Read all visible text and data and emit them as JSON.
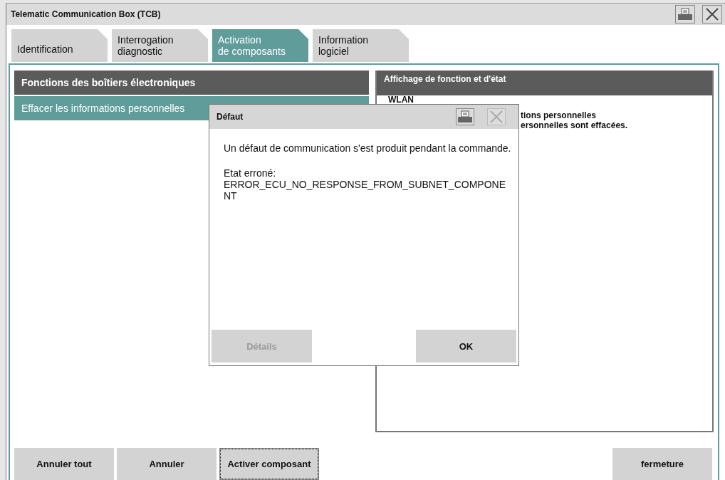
{
  "window": {
    "title": "Telematic Communication Box (TCB)"
  },
  "tabs": [
    {
      "label": "Identification",
      "selected": false
    },
    {
      "label": "Interrogation\ndiagnostic",
      "selected": false
    },
    {
      "label": "Activation\nde composants",
      "selected": true
    },
    {
      "label": "Information\nlogiciel",
      "selected": false
    }
  ],
  "functions_panel": {
    "title": "Fonctions des boîtiers électroniques",
    "items": [
      {
        "label": "Effacer les informations personnelles",
        "selected": true
      }
    ]
  },
  "status_panel": {
    "title": "Affichage de fonction et d'état",
    "heading": "WLAN",
    "lines": [
      "tions personnelles",
      "ersonnelles sont effacées."
    ]
  },
  "dialog": {
    "title": "Défaut",
    "message": "Un défaut de communication s'est produit pendant la commande.",
    "error_label": "Etat erroné:",
    "error_code": "ERROR_ECU_NO_RESPONSE_FROM_SUBNET_COMPONENT",
    "buttons": [
      {
        "label": "Détails",
        "disabled": true
      },
      {
        "label": "OK",
        "disabled": false
      }
    ]
  },
  "bottom_buttons": [
    {
      "label": "Annuler tout",
      "focused": false
    },
    {
      "label": "Annuler",
      "focused": false
    },
    {
      "label": "Activer composant",
      "focused": true
    },
    {
      "label": "fermeture",
      "focused": false
    }
  ]
}
